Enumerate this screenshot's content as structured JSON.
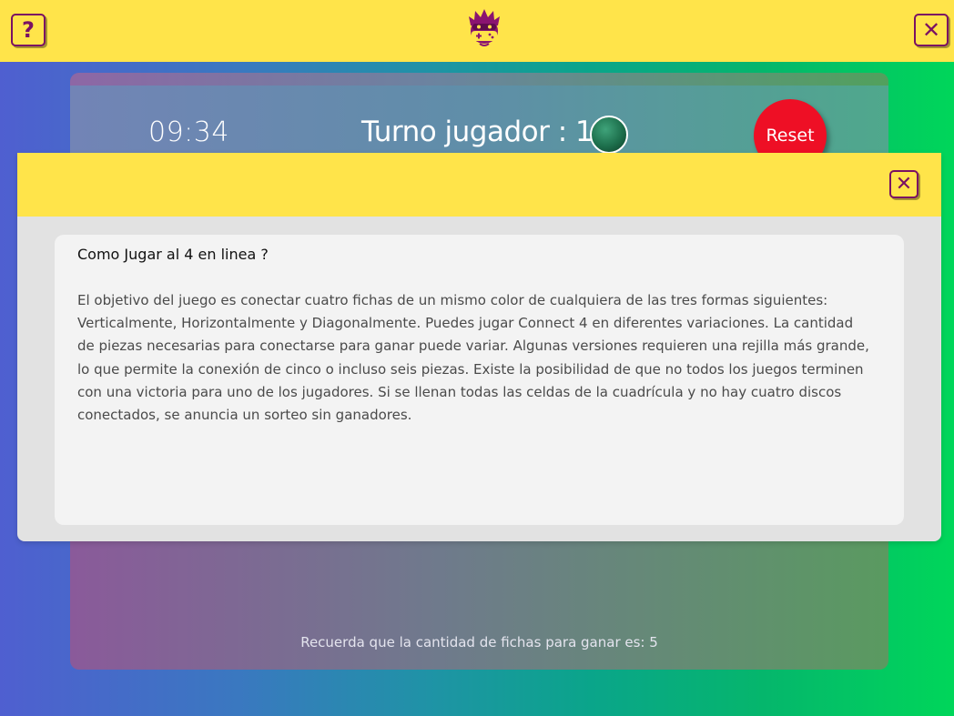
{
  "topbar": {
    "help_label": "?",
    "close_label": "✕",
    "logo_icon": "gamer-mascot-icon"
  },
  "game": {
    "timer": "09:34",
    "turn_label": "Turno jugador : 1",
    "player_color": "#1d6f4c",
    "reset_label": "Reset",
    "reminder": "Recuerda que la cantidad de fichas para ganar es: 5"
  },
  "modal": {
    "close_label": "✕",
    "title": "Como Jugar al 4 en linea ?",
    "body": "El objetivo del juego es conectar cuatro fichas de un mismo color de cualquiera de las tres formas siguientes: Verticalmente, Horizontalmente y Diagonalmente. Puedes jugar Connect 4 en diferentes variaciones. La cantidad de piezas necesarias para conectarse para ganar puede variar. Algunas versiones requieren una rejilla más grande, lo que permite la conexión de cinco o incluso seis piezas. Existe la posibilidad de que no todos los juegos terminen con una victoria para uno de los jugadores. Si se llenan todas las celdas de la cuadrícula y no hay cuatro discos conectados, se anuncia un sorteo sin ganadores."
  },
  "colors": {
    "accent_yellow": "#ffe44a",
    "icon_purple": "#7a1163",
    "reset_red": "#ee0f25"
  }
}
